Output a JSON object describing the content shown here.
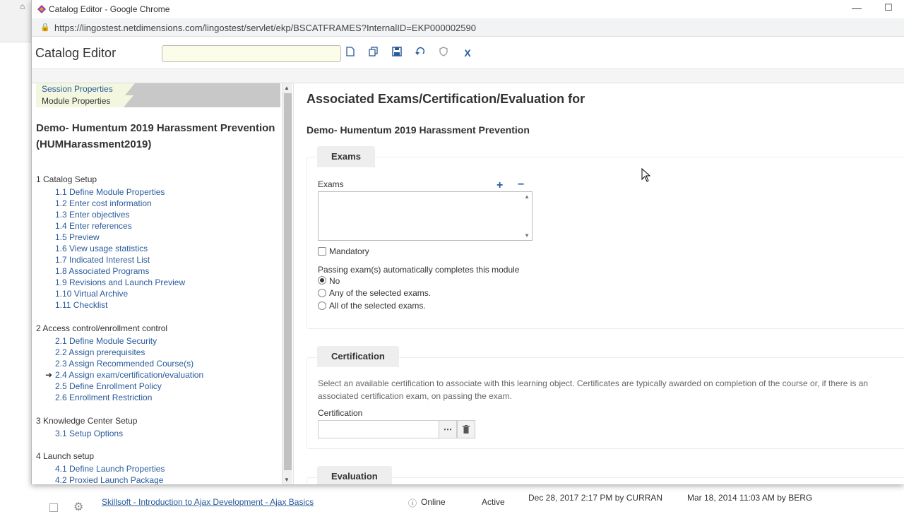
{
  "browser": {
    "window_title": "Catalog Editor - Google Chrome",
    "url": "https://lingostest.netdimensions.com/lingostest/servlet/ekp/BSCATFRAMES?InternalID=EKP000002590"
  },
  "toolbar": {
    "app_title": "Catalog Editor",
    "search_value": "",
    "buttons": [
      "new-document-icon",
      "copy-icon",
      "save-icon",
      "undo-icon",
      "shield-icon",
      "close-x-icon"
    ]
  },
  "sidebar": {
    "tabs": [
      "Session Properties",
      "Module Properties"
    ],
    "module_title": "Demo- Humentum 2019 Harassment Prevention (HUMHarassment2019)",
    "sections": [
      {
        "title": "1 Catalog Setup",
        "items": [
          "1.1 Define Module Properties",
          "1.2 Enter cost information",
          "1.3 Enter objectives",
          "1.4 Enter references",
          "1.5 Preview",
          "1.6 View usage statistics",
          "1.7 Indicated Interest List",
          "1.8 Associated Programs",
          "1.9 Revisions and Launch Preview",
          "1.10 Virtual Archive",
          "1.11 Checklist"
        ]
      },
      {
        "title": "2 Access control/enrollment control",
        "items": [
          "2.1 Define Module Security",
          "2.2 Assign prerequisites",
          "2.3 Assign Recommended Course(s)",
          "2.4 Assign exam/certification/evaluation",
          "2.5 Define Enrollment Policy",
          "2.6 Enrollment Restriction"
        ]
      },
      {
        "title": "3 Knowledge Center Setup",
        "items": [
          "3.1 Setup Options"
        ]
      },
      {
        "title": "4 Launch setup",
        "items": [
          "4.1 Define Launch Properties",
          "4.2 Proxied Launch Package"
        ]
      }
    ],
    "active_item": "2.4 Assign exam/certification/evaluation"
  },
  "main": {
    "heading": "Associated Exams/Certification/Evaluation for",
    "subheading": "Demo- Humentum 2019 Harassment Prevention",
    "exams": {
      "tab_label": "Exams",
      "field_label": "Exams",
      "add_label": "+",
      "remove_label": "−",
      "mandatory_label": "Mandatory",
      "mandatory_checked": false,
      "passing_label": "Passing exam(s) automatically completes this module",
      "options": [
        "No",
        "Any of the selected exams.",
        "All of the selected exams."
      ],
      "selected_option": "No"
    },
    "certification": {
      "tab_label": "Certification",
      "description": "Select an available certification to associate with this learning object. Certificates are typically awarded on completion of the course or, if there is an associated certification exam, on passing the exam.",
      "field_label": "Certification",
      "value": ""
    },
    "evaluation": {
      "tab_label": "Evaluation"
    }
  },
  "background_row": {
    "title": "Skillsoft - Introduction to Ajax Development - Ajax Basics",
    "delivery": "Online",
    "status": "Active",
    "modified": "Dec 28, 2017 2:17 PM by CURRAN",
    "created": "Mar 18, 2014 11:03 AM by BERG"
  }
}
